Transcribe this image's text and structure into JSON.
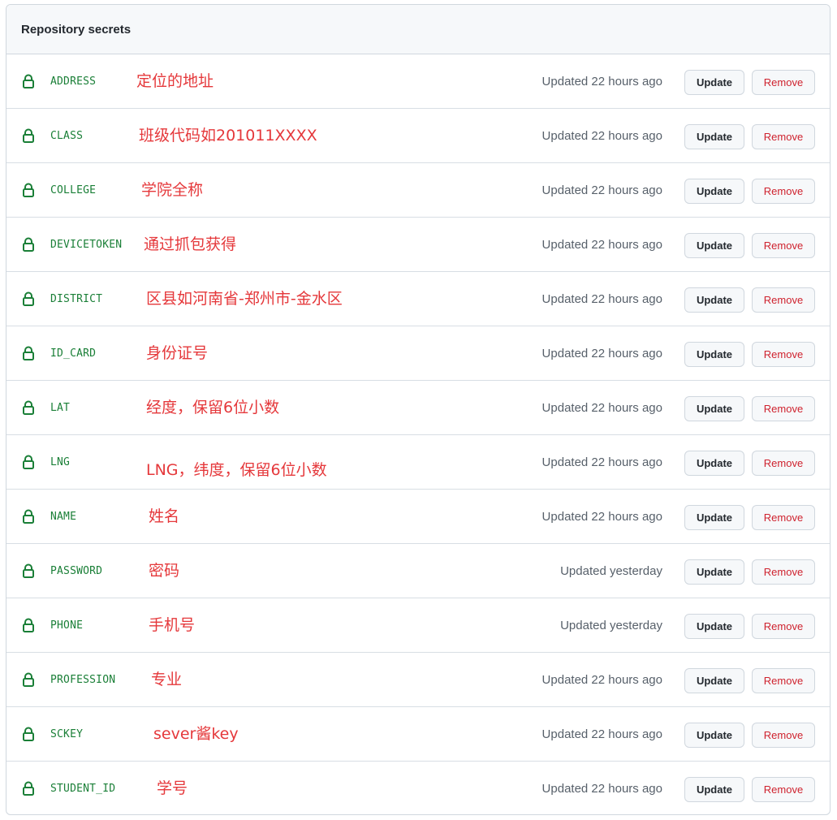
{
  "header": {
    "title": "Repository secrets"
  },
  "buttons": {
    "update_label": "Update",
    "remove_label": "Remove"
  },
  "colors": {
    "secret_name": "#1a7f37",
    "annotation": "#e5383b",
    "remove": "#cf222e"
  },
  "secrets": [
    {
      "name": "ADDRESS",
      "note": "定位的地址",
      "updated": "Updated 22 hours ago"
    },
    {
      "name": "CLASS",
      "note": "班级代码如201011XXXX",
      "updated": "Updated 22 hours ago"
    },
    {
      "name": "COLLEGE",
      "note": "学院全称",
      "updated": "Updated 22 hours ago"
    },
    {
      "name": "DEVICETOKEN",
      "note": "通过抓包获得",
      "updated": "Updated 22 hours ago"
    },
    {
      "name": "DISTRICT",
      "note": "区县如河南省-郑州市-金水区",
      "updated": "Updated 22 hours ago"
    },
    {
      "name": "ID_CARD",
      "note": "身份证号",
      "updated": "Updated 22 hours ago"
    },
    {
      "name": "LAT",
      "note": "经度，保留6位小数",
      "updated": "Updated 22 hours ago"
    },
    {
      "name": "LNG",
      "note": "LNG，纬度，保留6位小数",
      "updated": "Updated 22 hours ago"
    },
    {
      "name": "NAME",
      "note": "姓名",
      "updated": "Updated 22 hours ago"
    },
    {
      "name": "PASSWORD",
      "note": "密码",
      "updated": "Updated yesterday"
    },
    {
      "name": "PHONE",
      "note": "手机号",
      "updated": "Updated yesterday"
    },
    {
      "name": "PROFESSION",
      "note": "专业",
      "updated": "Updated 22 hours ago"
    },
    {
      "name": "SCKEY",
      "note": "sever酱key",
      "updated": "Updated 22 hours ago"
    },
    {
      "name": "STUDENT_ID",
      "note": "学号",
      "updated": "Updated 22 hours ago"
    }
  ]
}
